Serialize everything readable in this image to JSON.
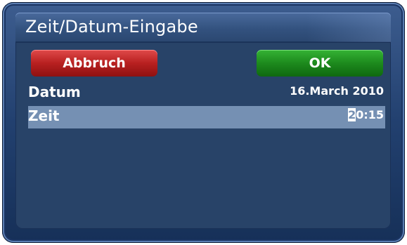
{
  "dialog": {
    "title": "Zeit/Datum-Eingabe"
  },
  "buttons": {
    "cancel_label": "Abbruch",
    "ok_label": "OK"
  },
  "fields": {
    "date": {
      "label": "Datum",
      "value": "16.March 2010"
    },
    "time": {
      "label": "Zeit",
      "value_cursor": "2",
      "value_rest": "0:15"
    }
  },
  "colors": {
    "cancel_button": "#b82020",
    "ok_button": "#1d8a1d",
    "selected_row": "#7590b3",
    "dialog_background": "#284368"
  }
}
